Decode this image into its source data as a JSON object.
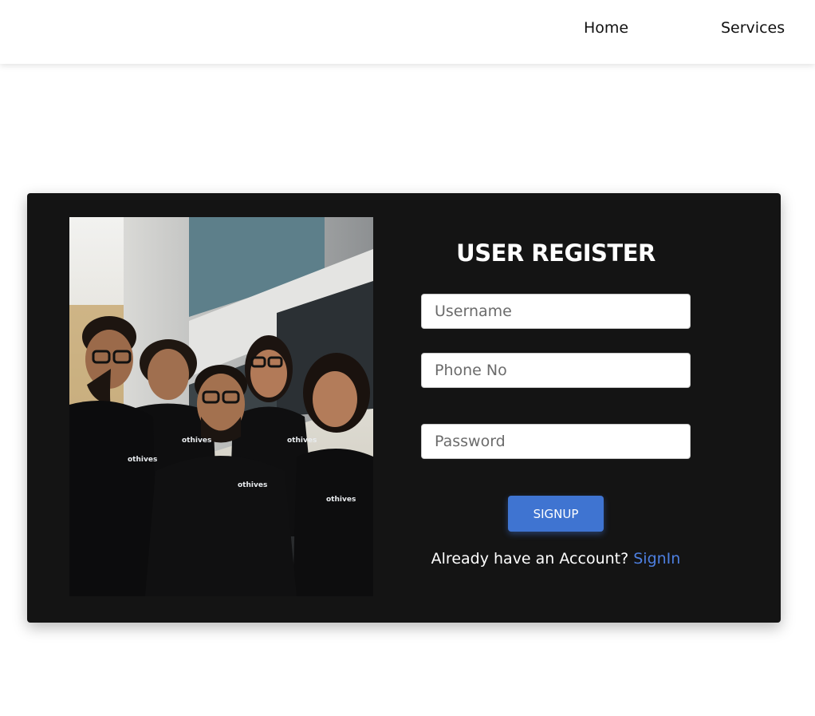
{
  "nav": {
    "home_label": "Home",
    "services_label": "Services"
  },
  "register": {
    "title": "USER REGISTER",
    "username_placeholder": "Username",
    "phone_placeholder": "Phone No",
    "password_placeholder": "Password",
    "signup_label": "SIGNUP",
    "account_prompt": "Already have an Account?",
    "signin_label": "SignIn"
  },
  "photo": {
    "shirt_logo_text": "othives",
    "alt": "Team photo of five smiling people in black t-shirts"
  },
  "colors": {
    "card_background": "#141414",
    "button": "#3f74d1",
    "link": "#4d7fe0"
  }
}
